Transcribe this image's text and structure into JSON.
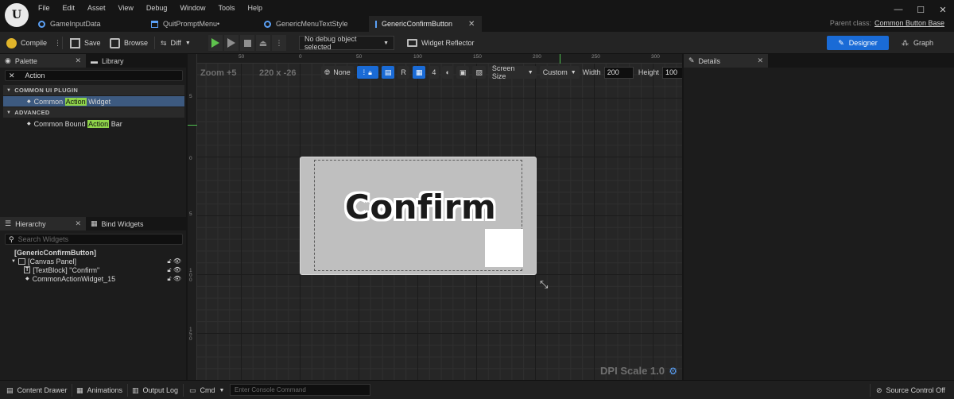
{
  "menu": [
    "File",
    "Edit",
    "Asset",
    "View",
    "Debug",
    "Window",
    "Tools",
    "Help"
  ],
  "tabs": [
    {
      "label": "GameInputData",
      "icon": "data-asset-icon"
    },
    {
      "label": "QuitPromptMenu•",
      "icon": "widget-blueprint-icon"
    },
    {
      "label": "GenericMenuTextStyle",
      "icon": "style-asset-icon"
    },
    {
      "label": "GenericConfirmButton",
      "icon": "widget-blueprint-icon",
      "active": true
    }
  ],
  "parent_class": {
    "label": "Parent class:",
    "value": "Common Button Base"
  },
  "toolbar": {
    "compile": "Compile",
    "save": "Save",
    "browse": "Browse",
    "diff": "Diff",
    "debug_object": "No debug object selected",
    "widget_reflector": "Widget Reflector",
    "designer": "Designer",
    "graph": "Graph"
  },
  "palette": {
    "tab": "Palette",
    "library_tab": "Library",
    "search_value": "Action",
    "categories": [
      {
        "name": "COMMON UI PLUGIN",
        "items": [
          {
            "pre": "Common ",
            "match": "Action",
            "post": " Widget",
            "selected": true
          }
        ]
      },
      {
        "name": "ADVANCED",
        "items": [
          {
            "pre": "Common Bound ",
            "match": "Action",
            "post": " Bar",
            "selected": false
          }
        ]
      }
    ]
  },
  "hierarchy": {
    "tab": "Hierarchy",
    "bind_tab": "Bind Widgets",
    "search_placeholder": "Search Widgets",
    "root": "[GenericConfirmButton]",
    "items": [
      "[Canvas Panel]",
      "[TextBlock] \"Confirm\"",
      "CommonActionWidget_15"
    ]
  },
  "canvas": {
    "zoom": "Zoom +5",
    "size": "220 x -26",
    "preview_text": "Confirm",
    "toolbar": {
      "none": "None",
      "grid_value": "4",
      "screen_size": "Screen Size",
      "custom": "Custom",
      "width_label": "Width",
      "width_value": "200",
      "height_label": "Height",
      "height_value": "100"
    },
    "ruler_top": [
      "50",
      "0",
      "50",
      "100",
      "150",
      "200",
      "250",
      "300"
    ],
    "ruler_left": [
      "5",
      "0",
      "5",
      "1 0 0",
      "1 5 0"
    ],
    "dpi": "DPI Scale 1.0"
  },
  "details": {
    "tab": "Details"
  },
  "statusbar": {
    "content_drawer": "Content Drawer",
    "animations": "Animations",
    "output_log": "Output Log",
    "cmd": "Cmd",
    "console_placeholder": "Enter Console Command",
    "source_control": "Source Control Off"
  },
  "colors": {
    "accent": "#1a6bd6",
    "highlight": "#8fd44a",
    "play": "#5ec24d"
  }
}
